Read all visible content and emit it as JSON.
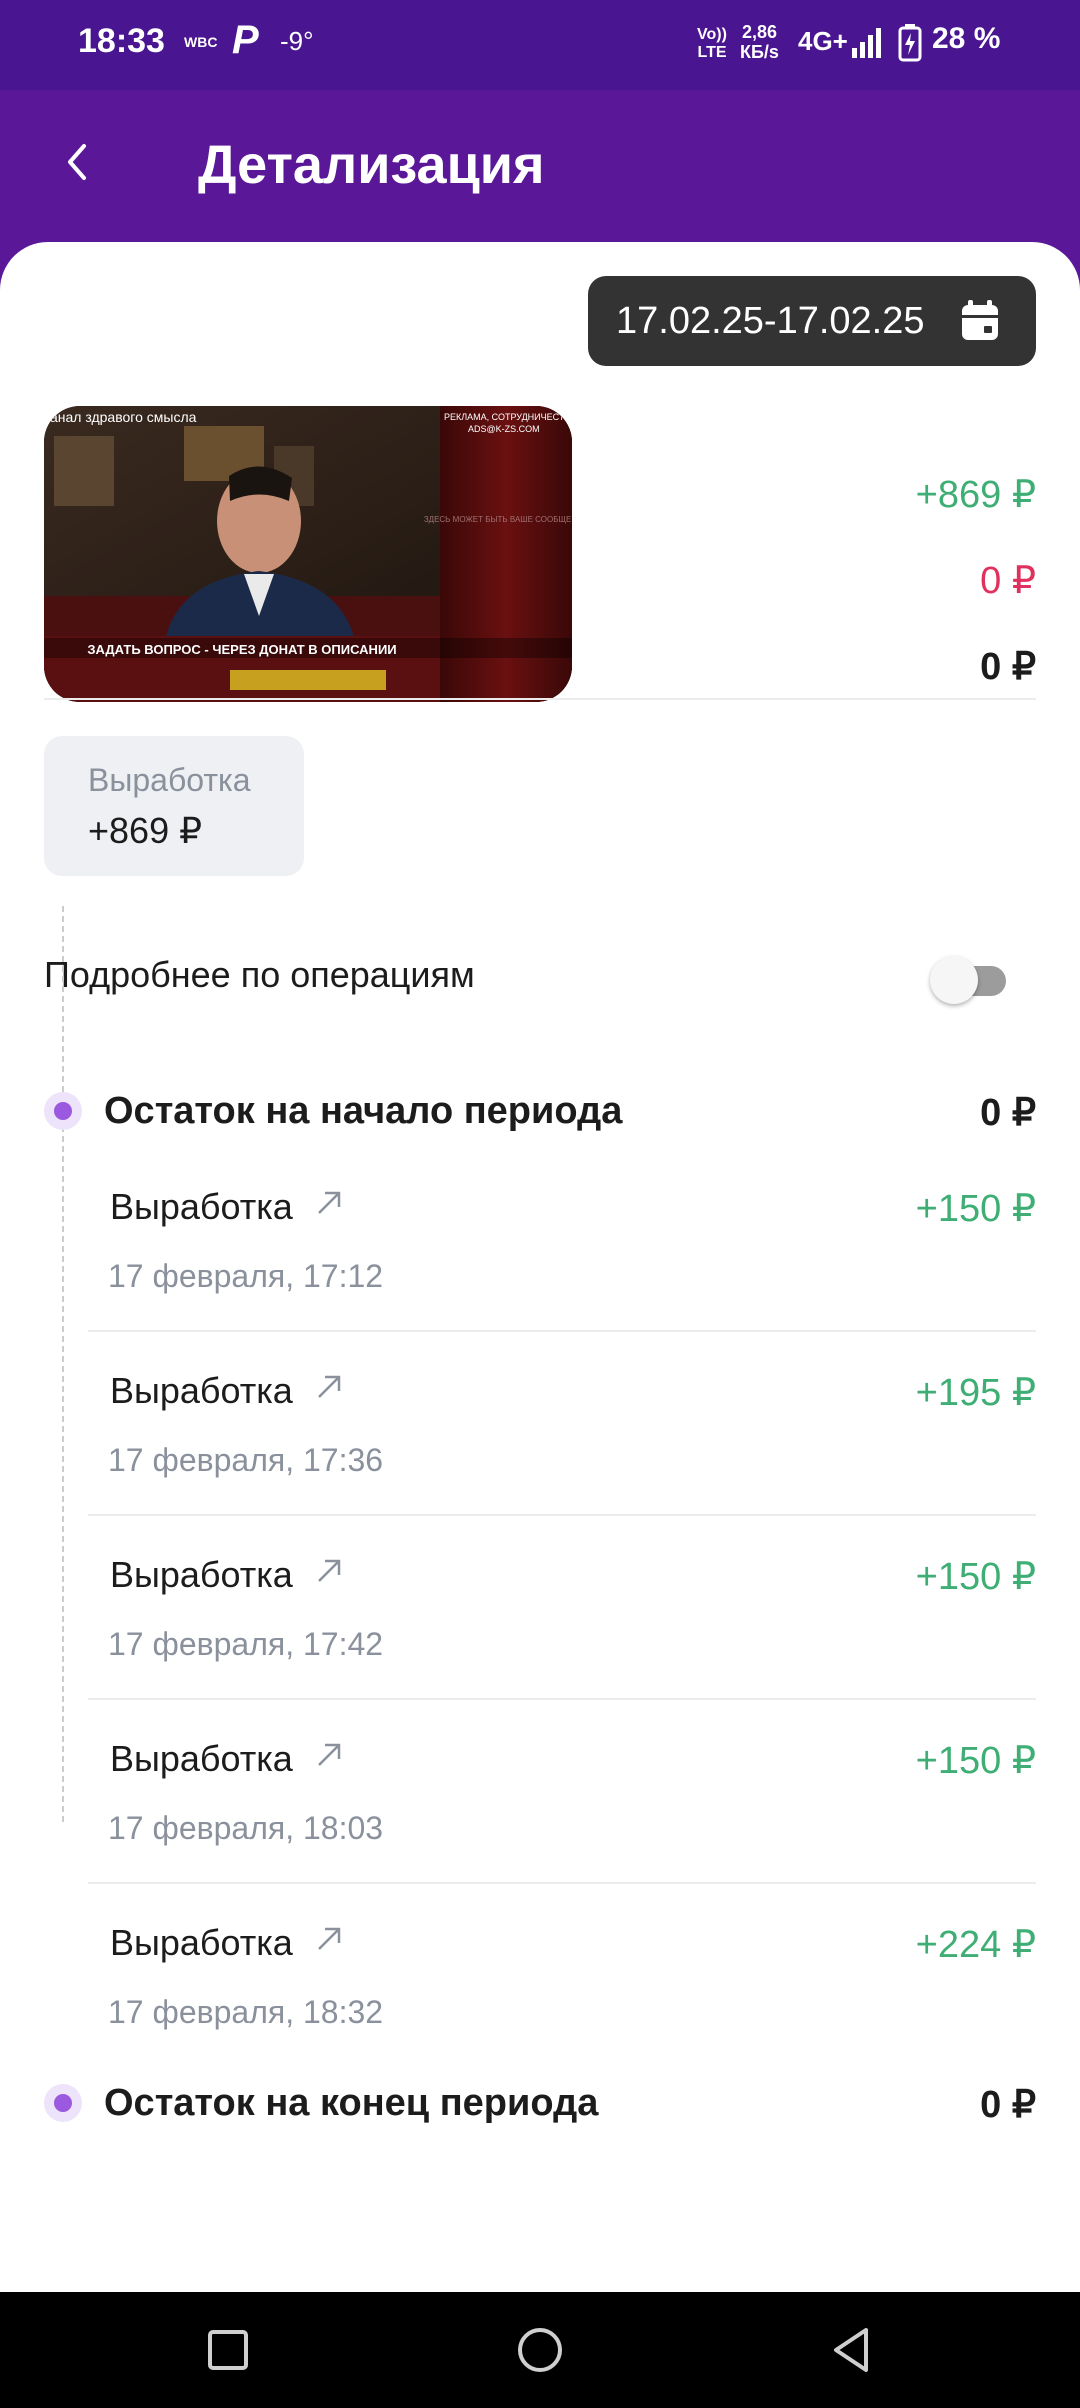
{
  "status_bar": {
    "time": "18:33",
    "carrier_small": "WBC",
    "p_icon": "P",
    "temperature": "-9°",
    "volte": "Vo)) LTE",
    "net_speed_value": "2,86",
    "net_speed_unit": "КБ/s",
    "network": "4G+",
    "battery": "28 %",
    "icons": [
      "signal-icon",
      "battery-charging-icon"
    ]
  },
  "app_bar": {
    "title": "Детализация",
    "back_icon": "back-arrow-icon"
  },
  "date_filter": {
    "range": "17.02.25-17.02.25",
    "icon": "calendar-icon"
  },
  "video": {
    "channel_caption": "анал здравого смысла",
    "ad_caption": "РЕКЛАМА, СОТРУДНИЧЕСТВО",
    "ad_email": "ADS@K-ZS.COM",
    "side_text": "ЗДЕСЬ МОЖЕТ БЫТЬ ВАШЕ СООБЩЕНИЕ",
    "banner_text": "ЗАДАТЬ ВОПРОС - ЧЕРЕЗ ДОНАТ В ОПИСАНИИ"
  },
  "summary_amounts": {
    "income": "+869 ₽",
    "expense": "0 ₽",
    "balance": "0 ₽"
  },
  "summary_card": {
    "label": "Выработка",
    "value": "+869 ₽"
  },
  "details_toggle": {
    "label": "Подробнее по операциям",
    "enabled": false
  },
  "period_start": {
    "label": "Остаток на начало периода",
    "amount": "0 ₽"
  },
  "operations": [
    {
      "title": "Выработка",
      "date": "17 февраля, 17:12",
      "amount": "+150 ₽"
    },
    {
      "title": "Выработка",
      "date": "17 февраля, 17:36",
      "amount": "+195 ₽"
    },
    {
      "title": "Выработка",
      "date": "17 февраля, 17:42",
      "amount": "+150 ₽"
    },
    {
      "title": "Выработка",
      "date": "17 февраля, 18:03",
      "amount": "+150 ₽"
    },
    {
      "title": "Выработка",
      "date": "17 февраля, 18:32",
      "amount": "+224 ₽"
    }
  ],
  "period_end": {
    "label": "Остаток на конец периода",
    "amount": "0 ₽"
  },
  "nav_bar": {
    "buttons": [
      "recents-icon",
      "home-icon",
      "back-icon"
    ]
  },
  "colors": {
    "header": "#5a1899",
    "positive": "#3fae74",
    "negative": "#e0305e",
    "timeline_dot": "#9b59e0"
  }
}
